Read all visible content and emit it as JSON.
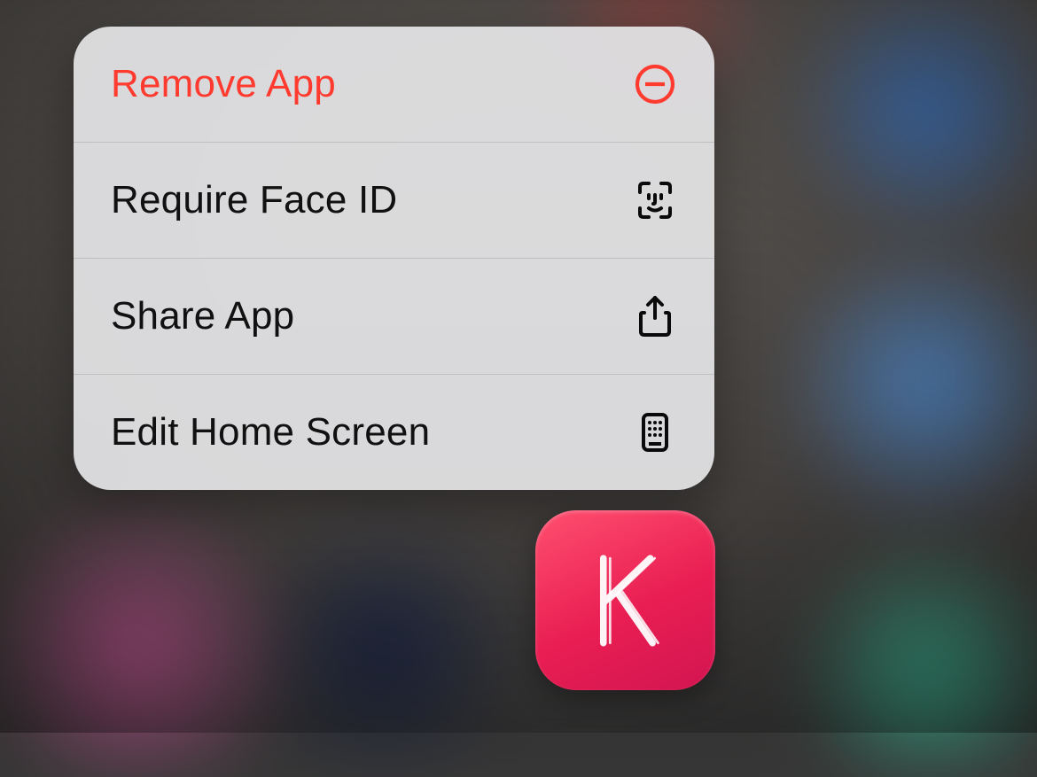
{
  "menu": {
    "remove": {
      "label": "Remove App",
      "icon": "minus-circle-icon",
      "destructive": true
    },
    "faceid": {
      "label": "Require Face ID",
      "icon": "face-id-icon"
    },
    "share": {
      "label": "Share App",
      "icon": "share-icon"
    },
    "edit": {
      "label": "Edit Home Screen",
      "icon": "apps-grid-icon"
    }
  },
  "app": {
    "letter": "K",
    "color": "#e91e53"
  }
}
